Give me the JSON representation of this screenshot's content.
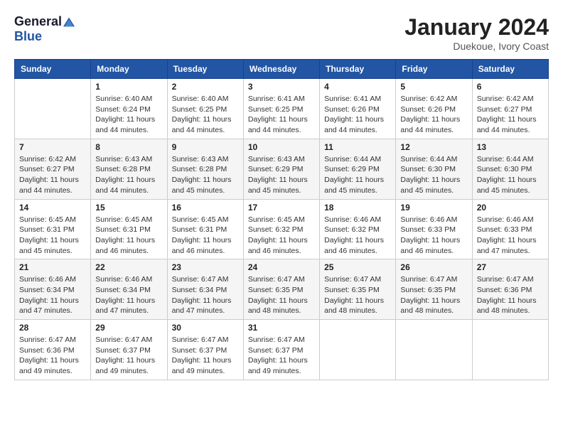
{
  "logo": {
    "general": "General",
    "blue": "Blue"
  },
  "title": "January 2024",
  "location": "Duekoue, Ivory Coast",
  "days_of_week": [
    "Sunday",
    "Monday",
    "Tuesday",
    "Wednesday",
    "Thursday",
    "Friday",
    "Saturday"
  ],
  "weeks": [
    [
      {
        "day": "",
        "info": ""
      },
      {
        "day": "1",
        "info": "Sunrise: 6:40 AM\nSunset: 6:24 PM\nDaylight: 11 hours\nand 44 minutes."
      },
      {
        "day": "2",
        "info": "Sunrise: 6:40 AM\nSunset: 6:25 PM\nDaylight: 11 hours\nand 44 minutes."
      },
      {
        "day": "3",
        "info": "Sunrise: 6:41 AM\nSunset: 6:25 PM\nDaylight: 11 hours\nand 44 minutes."
      },
      {
        "day": "4",
        "info": "Sunrise: 6:41 AM\nSunset: 6:26 PM\nDaylight: 11 hours\nand 44 minutes."
      },
      {
        "day": "5",
        "info": "Sunrise: 6:42 AM\nSunset: 6:26 PM\nDaylight: 11 hours\nand 44 minutes."
      },
      {
        "day": "6",
        "info": "Sunrise: 6:42 AM\nSunset: 6:27 PM\nDaylight: 11 hours\nand 44 minutes."
      }
    ],
    [
      {
        "day": "7",
        "info": "Sunrise: 6:42 AM\nSunset: 6:27 PM\nDaylight: 11 hours\nand 44 minutes."
      },
      {
        "day": "8",
        "info": "Sunrise: 6:43 AM\nSunset: 6:28 PM\nDaylight: 11 hours\nand 44 minutes."
      },
      {
        "day": "9",
        "info": "Sunrise: 6:43 AM\nSunset: 6:28 PM\nDaylight: 11 hours\nand 45 minutes."
      },
      {
        "day": "10",
        "info": "Sunrise: 6:43 AM\nSunset: 6:29 PM\nDaylight: 11 hours\nand 45 minutes."
      },
      {
        "day": "11",
        "info": "Sunrise: 6:44 AM\nSunset: 6:29 PM\nDaylight: 11 hours\nand 45 minutes."
      },
      {
        "day": "12",
        "info": "Sunrise: 6:44 AM\nSunset: 6:30 PM\nDaylight: 11 hours\nand 45 minutes."
      },
      {
        "day": "13",
        "info": "Sunrise: 6:44 AM\nSunset: 6:30 PM\nDaylight: 11 hours\nand 45 minutes."
      }
    ],
    [
      {
        "day": "14",
        "info": "Sunrise: 6:45 AM\nSunset: 6:31 PM\nDaylight: 11 hours\nand 45 minutes."
      },
      {
        "day": "15",
        "info": "Sunrise: 6:45 AM\nSunset: 6:31 PM\nDaylight: 11 hours\nand 46 minutes."
      },
      {
        "day": "16",
        "info": "Sunrise: 6:45 AM\nSunset: 6:31 PM\nDaylight: 11 hours\nand 46 minutes."
      },
      {
        "day": "17",
        "info": "Sunrise: 6:45 AM\nSunset: 6:32 PM\nDaylight: 11 hours\nand 46 minutes."
      },
      {
        "day": "18",
        "info": "Sunrise: 6:46 AM\nSunset: 6:32 PM\nDaylight: 11 hours\nand 46 minutes."
      },
      {
        "day": "19",
        "info": "Sunrise: 6:46 AM\nSunset: 6:33 PM\nDaylight: 11 hours\nand 46 minutes."
      },
      {
        "day": "20",
        "info": "Sunrise: 6:46 AM\nSunset: 6:33 PM\nDaylight: 11 hours\nand 47 minutes."
      }
    ],
    [
      {
        "day": "21",
        "info": "Sunrise: 6:46 AM\nSunset: 6:34 PM\nDaylight: 11 hours\nand 47 minutes."
      },
      {
        "day": "22",
        "info": "Sunrise: 6:46 AM\nSunset: 6:34 PM\nDaylight: 11 hours\nand 47 minutes."
      },
      {
        "day": "23",
        "info": "Sunrise: 6:47 AM\nSunset: 6:34 PM\nDaylight: 11 hours\nand 47 minutes."
      },
      {
        "day": "24",
        "info": "Sunrise: 6:47 AM\nSunset: 6:35 PM\nDaylight: 11 hours\nand 48 minutes."
      },
      {
        "day": "25",
        "info": "Sunrise: 6:47 AM\nSunset: 6:35 PM\nDaylight: 11 hours\nand 48 minutes."
      },
      {
        "day": "26",
        "info": "Sunrise: 6:47 AM\nSunset: 6:35 PM\nDaylight: 11 hours\nand 48 minutes."
      },
      {
        "day": "27",
        "info": "Sunrise: 6:47 AM\nSunset: 6:36 PM\nDaylight: 11 hours\nand 48 minutes."
      }
    ],
    [
      {
        "day": "28",
        "info": "Sunrise: 6:47 AM\nSunset: 6:36 PM\nDaylight: 11 hours\nand 49 minutes."
      },
      {
        "day": "29",
        "info": "Sunrise: 6:47 AM\nSunset: 6:37 PM\nDaylight: 11 hours\nand 49 minutes."
      },
      {
        "day": "30",
        "info": "Sunrise: 6:47 AM\nSunset: 6:37 PM\nDaylight: 11 hours\nand 49 minutes."
      },
      {
        "day": "31",
        "info": "Sunrise: 6:47 AM\nSunset: 6:37 PM\nDaylight: 11 hours\nand 49 minutes."
      },
      {
        "day": "",
        "info": ""
      },
      {
        "day": "",
        "info": ""
      },
      {
        "day": "",
        "info": ""
      }
    ]
  ]
}
